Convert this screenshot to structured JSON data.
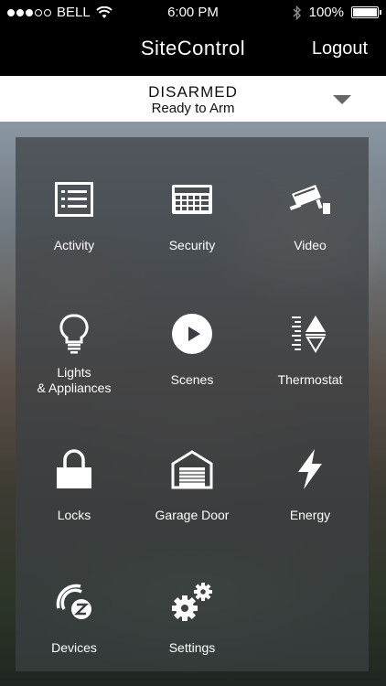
{
  "status_bar": {
    "carrier": "BELL",
    "time": "6:00 PM",
    "battery": "100%"
  },
  "nav": {
    "title": "SiteControl",
    "logout_label": "Logout"
  },
  "arm": {
    "state": "DISARMED",
    "subtitle": "Ready to Arm"
  },
  "tiles": [
    {
      "label": "Activity",
      "icon": "list-icon"
    },
    {
      "label": "Security",
      "icon": "keypad-icon"
    },
    {
      "label": "Video",
      "icon": "camera-icon"
    },
    {
      "label": "Lights\n& Appliances",
      "icon": "lightbulb-icon"
    },
    {
      "label": "Scenes",
      "icon": "play-icon"
    },
    {
      "label": "Thermostat",
      "icon": "thermostat-icon"
    },
    {
      "label": "Locks",
      "icon": "lock-icon"
    },
    {
      "label": "Garage Door",
      "icon": "garage-icon"
    },
    {
      "label": "Energy",
      "icon": "lightning-icon"
    },
    {
      "label": "Devices",
      "icon": "zwave-icon"
    },
    {
      "label": "Settings",
      "icon": "gears-icon"
    }
  ]
}
